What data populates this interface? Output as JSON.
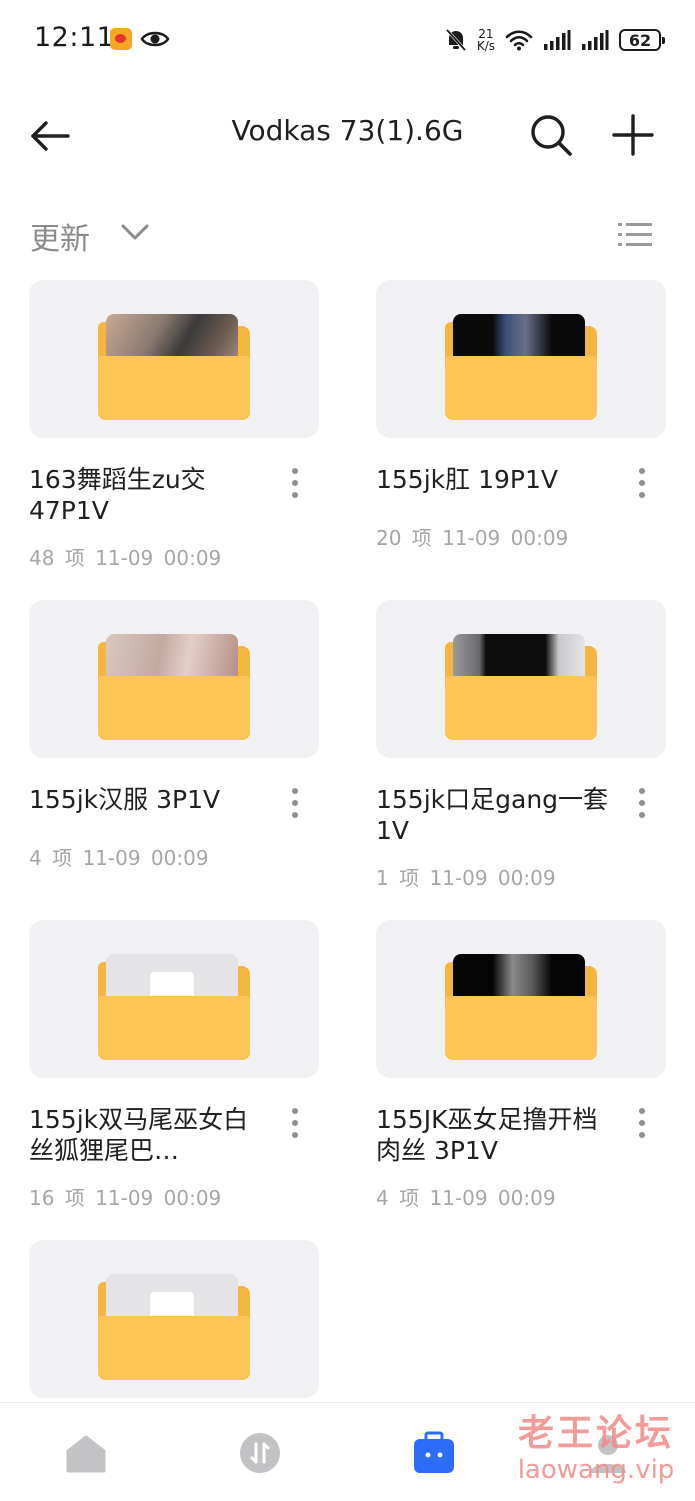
{
  "status_bar": {
    "time": "12:11",
    "speed_value": "21",
    "speed_unit": "K/s",
    "battery": "62"
  },
  "header": {
    "title": "Vodkas 73(1).6G"
  },
  "sort": {
    "label": "更新"
  },
  "items": [
    {
      "name": "163舞蹈生zu交47P1V",
      "meta": "48 项  11-09 00:09",
      "thumbnail": "photo"
    },
    {
      "name": "155jk肛 19P1V",
      "meta": "20 项  11-09 00:09",
      "thumbnail": "photo"
    },
    {
      "name": "155jk汉服 3P1V",
      "meta": "4 项  11-09 00:09",
      "thumbnail": "photo"
    },
    {
      "name": "155jk口足gang一套 1V",
      "meta": "1 项  11-09 00:09",
      "thumbnail": "photo"
    },
    {
      "name": "155jk双马尾巫女白丝狐狸尾巴…",
      "meta": "16 项  11-09 00:09",
      "thumbnail": "blank"
    },
    {
      "name": "155JK巫女足撸开档肉丝 3P1V",
      "meta": "4 项  11-09 00:09",
      "thumbnail": "photo"
    },
    {
      "name": "",
      "meta": "",
      "thumbnail": "blank"
    }
  ],
  "bottom_nav": [
    {
      "icon": "home-icon"
    },
    {
      "icon": "transfer-icon"
    },
    {
      "icon": "files-icon",
      "active": true
    },
    {
      "icon": "profile-icon"
    }
  ],
  "watermark": {
    "line1": "老王论坛",
    "line2": "laowang.vip"
  },
  "colors": {
    "folder": "#fdc556",
    "accent": "#2d6cf6",
    "watermark": "#f28a8a"
  }
}
